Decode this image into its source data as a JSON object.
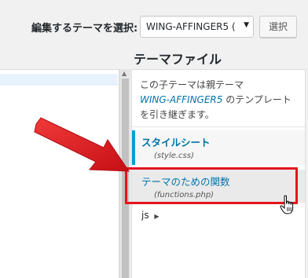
{
  "header": {
    "select_label": "編集するテーマを選択:",
    "selected_theme": "WING-AFFINGER5 (",
    "select_button": "選択"
  },
  "files_panel": {
    "heading": "テーマファイル",
    "note_prefix": "この子テーマは親テーマ",
    "parent_theme": "WING-AFFINGER5",
    "note_suffix_1": " のテンプレ",
    "note_suffix_2": "ート",
    "note_line3": "を引き継ぎます。",
    "files": [
      {
        "label": "スタイルシート",
        "filename": "(style.css)",
        "state": "active"
      },
      {
        "label": "テーマのための関数",
        "filename": "(functions.php)",
        "state": "hovered"
      }
    ],
    "folders": [
      {
        "label": "js"
      }
    ]
  },
  "annotation": {
    "highlight_color": "#e4141d",
    "arrow_color": "#e4141d"
  },
  "colors": {
    "link": "#0073aa",
    "active_border": "#00a0d2",
    "background": "#f1f1f1"
  },
  "icons": {
    "select_arrow": "chevron-down-icon",
    "folder_expand": "triangle-right-icon",
    "cursor": "hand-pointer-icon"
  }
}
